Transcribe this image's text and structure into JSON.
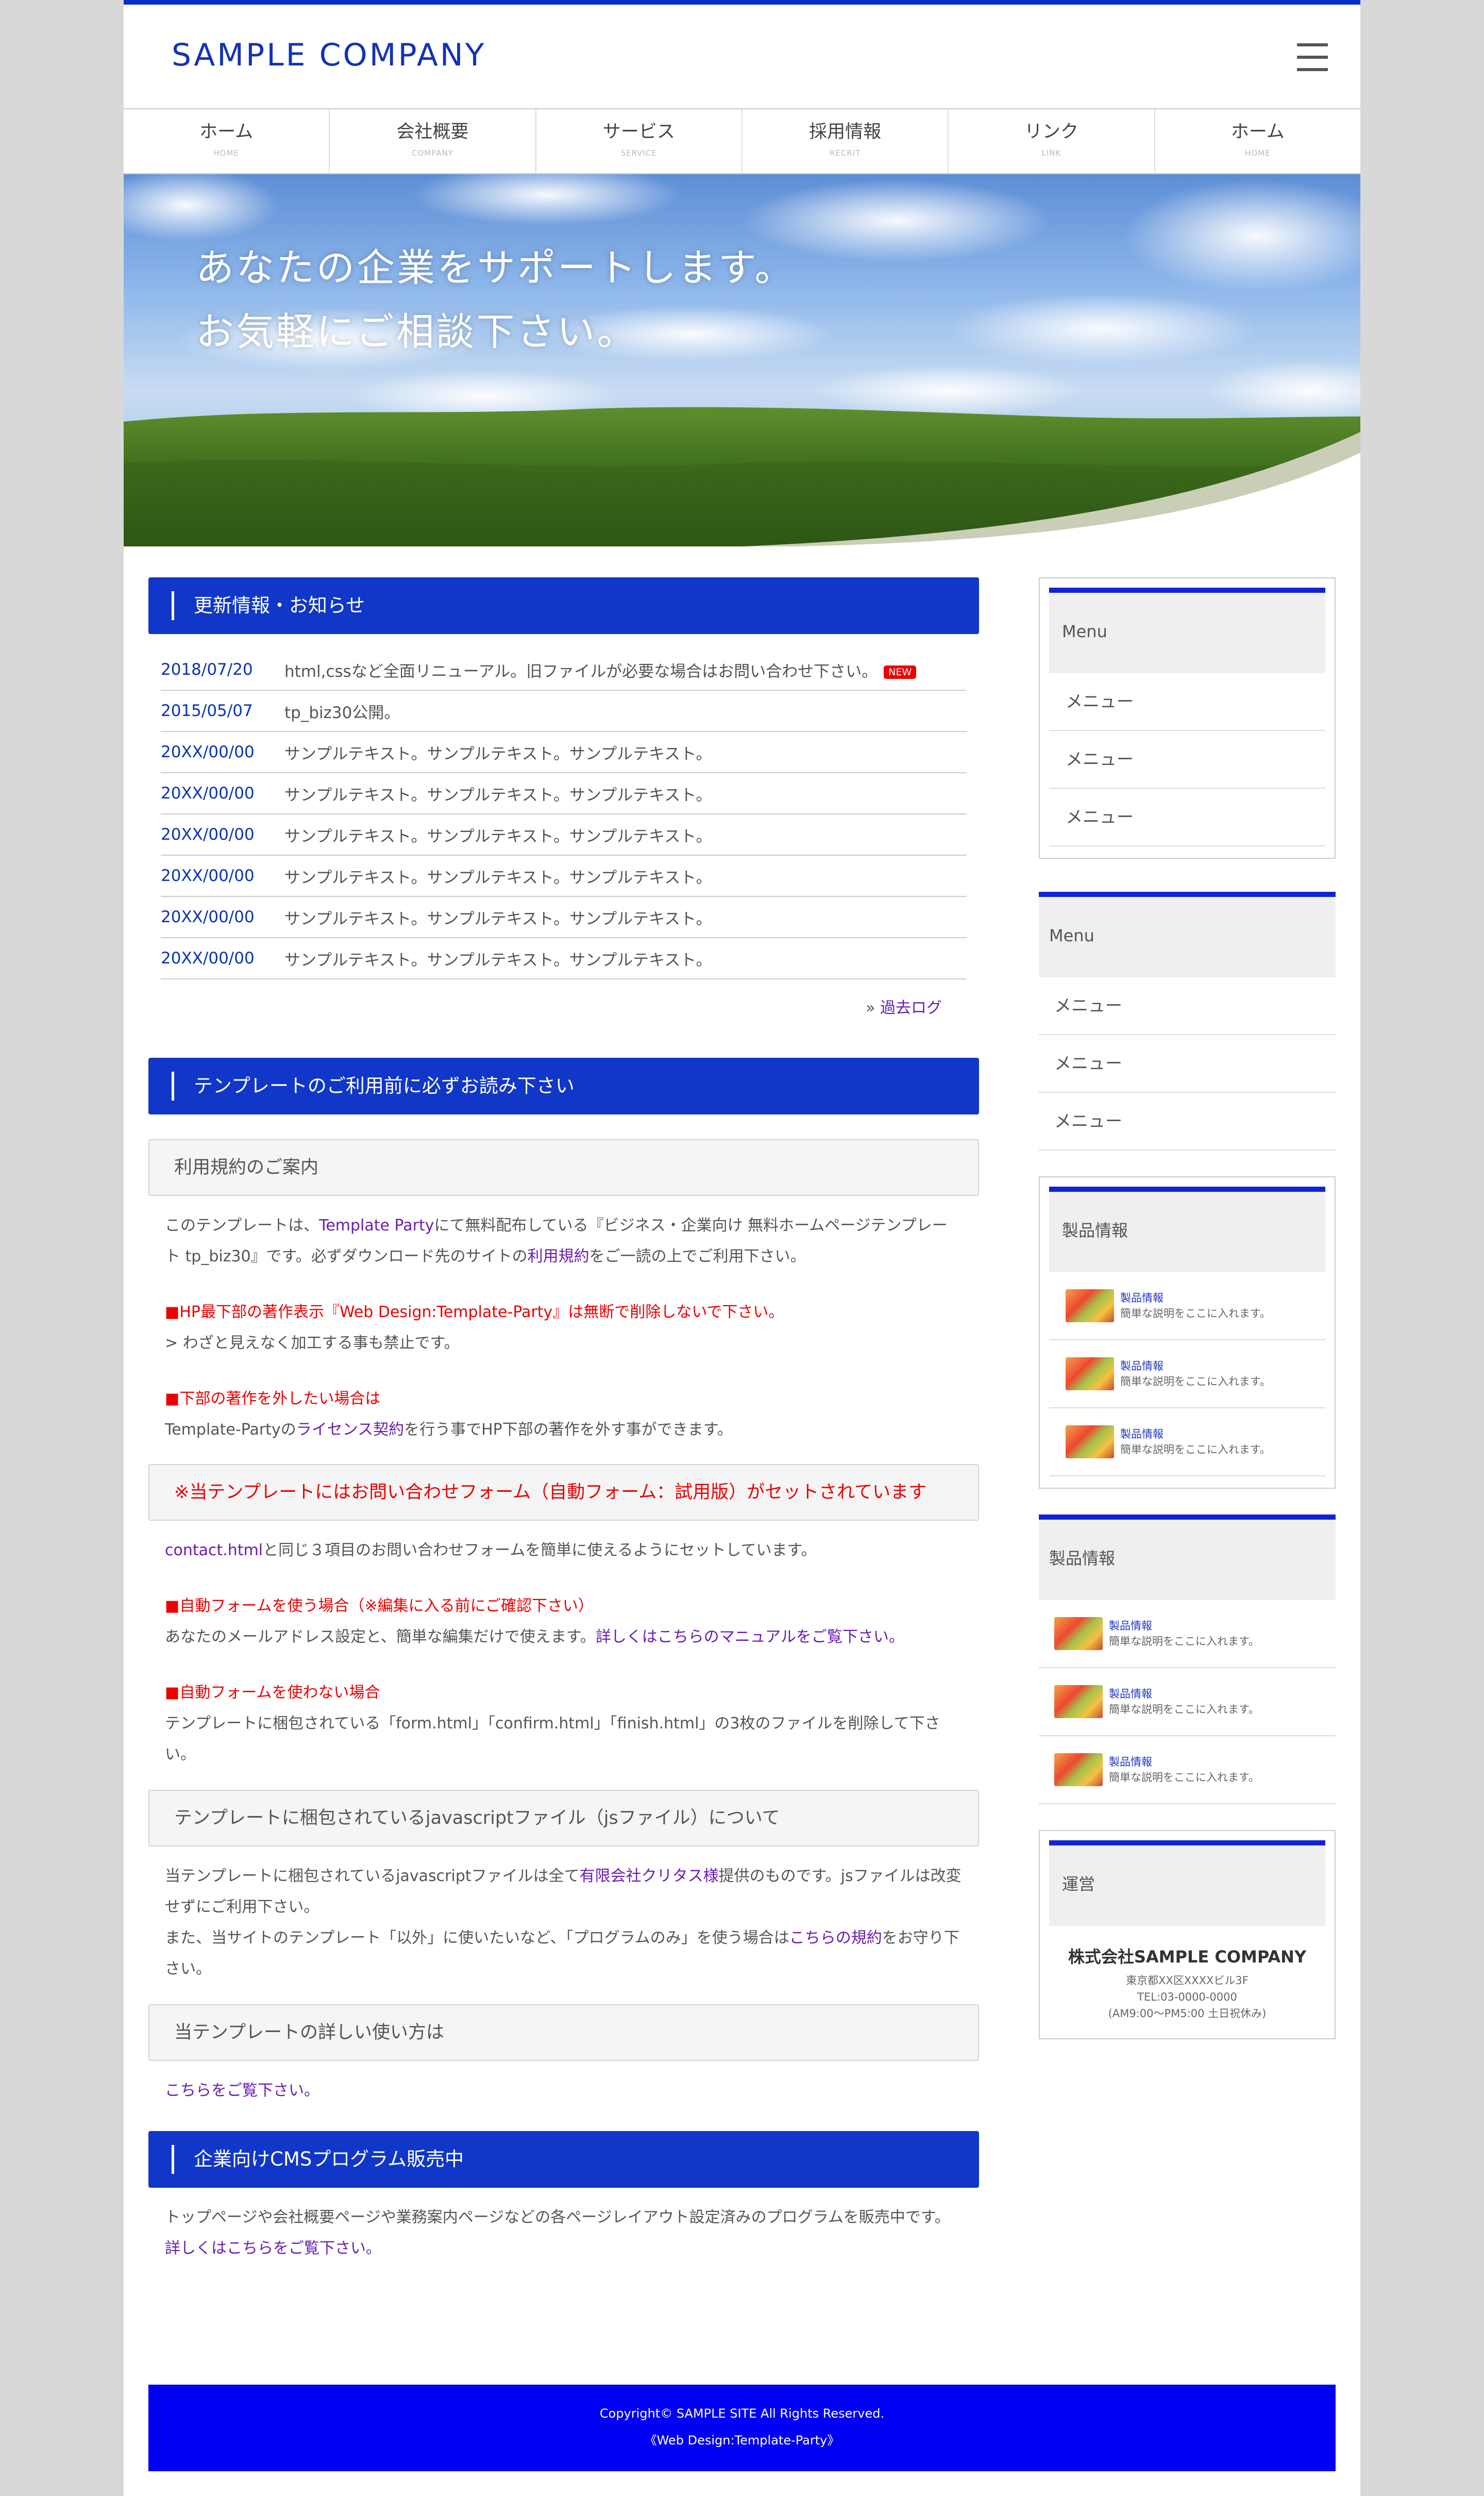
{
  "header": {
    "logo": "SAMPLE COMPANY"
  },
  "nav": [
    {
      "label": "ホーム",
      "sub": "HOME"
    },
    {
      "label": "会社概要",
      "sub": "COMPANY"
    },
    {
      "label": "サービス",
      "sub": "SERVICE"
    },
    {
      "label": "採用情報",
      "sub": "RECRIT"
    },
    {
      "label": "リンク",
      "sub": "LINK"
    },
    {
      "label": "ホーム",
      "sub": "HOME"
    }
  ],
  "hero": {
    "line1": "あなたの企業をサポートします。",
    "line2": "お気軽にご相談下さい。"
  },
  "news": {
    "heading": "更新情報・お知らせ",
    "items": [
      {
        "date": "2018/07/20",
        "text": "html,cssなど全面リニューアル。旧ファイルが必要な場合はお問い合わせ下さい。"
      },
      {
        "date": "2015/05/07",
        "text": "tp_biz30公開。"
      },
      {
        "date": "20XX/00/00",
        "text": "サンプルテキスト。サンプルテキスト。サンプルテキスト。"
      },
      {
        "date": "20XX/00/00",
        "text": "サンプルテキスト。サンプルテキスト。サンプルテキスト。"
      },
      {
        "date": "20XX/00/00",
        "text": "サンプルテキスト。サンプルテキスト。サンプルテキスト。"
      },
      {
        "date": "20XX/00/00",
        "text": "サンプルテキスト。サンプルテキスト。サンプルテキスト。"
      },
      {
        "date": "20XX/00/00",
        "text": "サンプルテキスト。サンプルテキスト。サンプルテキスト。"
      },
      {
        "date": "20XX/00/00",
        "text": "サンプルテキスト。サンプルテキスト。サンプルテキスト。"
      }
    ],
    "new_badge": "NEW",
    "past_prefix": "» ",
    "past_log": "過去ログ"
  },
  "readme": {
    "heading": "テンプレートのご利用前に必ずお読み下さい",
    "terms_heading": "利用規約のご案内",
    "p1a": "このテンプレートは、",
    "p1_link": "Template Party",
    "p1b": "にて無料配布している『ビジネス・企業向け 無料ホームページテンプレート tp_biz30』です。必ずダウンロード先のサイトの",
    "p1_link2": "利用規約",
    "p1c": "をご一読の上でご利用下さい。",
    "warn1": "■HP最下部の著作表示『Web Design:Template-Party』は無断で削除しないで下さい。",
    "warn1b": "> わざと見えなく加工する事も禁止です。",
    "warn2": "■下部の著作を外したい場合は",
    "warn2a": "Template-Partyの",
    "warn2_link": "ライセンス契約",
    "warn2b": "を行う事でHP下部の著作を外す事ができます。",
    "form_heading": "※当テンプレートにはお問い合わせフォーム（自動フォーム：試用版）がセットされています",
    "form_link": "contact.html",
    "form_p": "と同じ３項目のお問い合わせフォームを簡単に使えるようにセットしています。",
    "auto_use": "■自動フォームを使う場合（※編集に入る前にご確認下さい）",
    "auto_use_p": "あなたのメールアドレス設定と、簡単な編集だけで使えます。",
    "auto_use_link": "詳しくはこちらのマニュアルをご覧下さい。",
    "auto_no": "■自動フォームを使わない場合",
    "auto_no_p": "テンプレートに梱包されている「form.html」「confirm.html」「finish.html」の3枚のファイルを削除して下さい。",
    "js_heading": "テンプレートに梱包されているjavascriptファイル（jsファイル）について",
    "js_p1a": "当テンプレートに梱包されているjavascriptファイルは全て",
    "js_link": "有限会社クリタス様",
    "js_p1b": "提供のものです。jsファイルは改変せずにご利用下さい。",
    "js_p2a": "また、当サイトのテンプレート「以外」に使いたいなど、「プログラムのみ」を使う場合は",
    "js_link2": "こちらの規約",
    "js_p2b": "をお守り下さい。",
    "detail_heading": "当テンプレートの詳しい使い方は",
    "detail_link": "こちらをご覧下さい。"
  },
  "cms": {
    "heading": "企業向けCMSプログラム販売中",
    "p": "トップページや会社概要ページや業務案内ページなどの各ページレイアウト設定済みのプログラムを販売中です。",
    "link": "詳しくはこちらをご覧下さい。"
  },
  "side": {
    "menu1": {
      "title": "Menu",
      "items": [
        "メニュー",
        "メニュー",
        "メニュー"
      ]
    },
    "menu2": {
      "title": "Menu",
      "items": [
        "メニュー",
        "メニュー",
        "メニュー"
      ]
    },
    "prod1": {
      "title": "製品情報",
      "items": [
        {
          "name": "製品情報",
          "desc": "簡単な説明をここに入れます。"
        },
        {
          "name": "製品情報",
          "desc": "簡単な説明をここに入れます。"
        },
        {
          "name": "製品情報",
          "desc": "簡単な説明をここに入れます。"
        }
      ]
    },
    "prod2": {
      "title": "製品情報",
      "items": [
        {
          "name": "製品情報",
          "desc": "簡単な説明をここに入れます。"
        },
        {
          "name": "製品情報",
          "desc": "簡単な説明をここに入れます。"
        },
        {
          "name": "製品情報",
          "desc": "簡単な説明をここに入れます。"
        }
      ]
    },
    "company": {
      "title": "運営",
      "name": "株式会社SAMPLE COMPANY",
      "address": "東京都XX区XXXXビル3F",
      "tel": "TEL:03-0000-0000",
      "hours": "(AM9:00〜PM5:00 土日祝休み)"
    }
  },
  "footer": {
    "copy": "Copyright© SAMPLE SITE All Rights Reserved.",
    "credit": "《Web Design:Template-Party》"
  },
  "colors": {
    "accent": "#1037c7",
    "footer": "#0000f2",
    "alert": "#ee0000"
  }
}
